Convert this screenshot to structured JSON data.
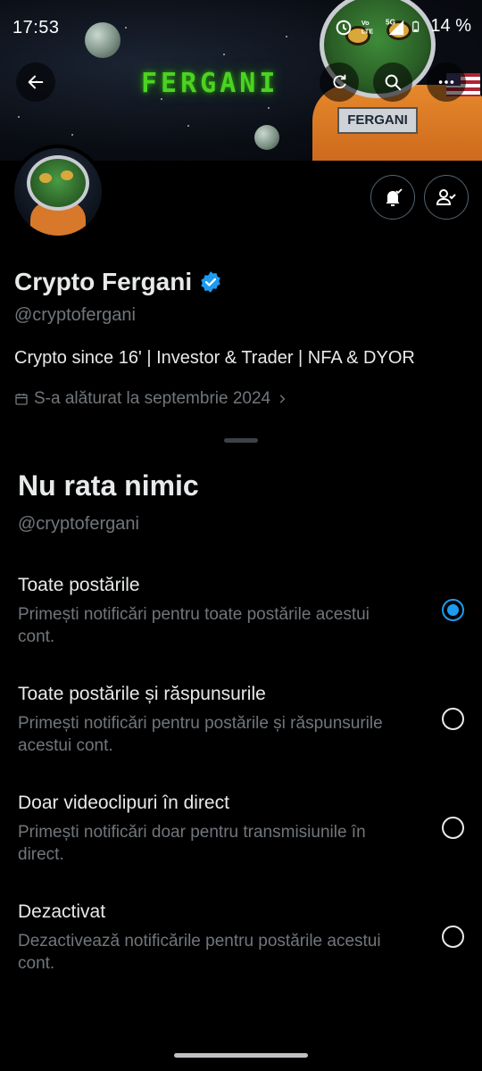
{
  "status_bar": {
    "time": "17:53",
    "battery": "14 %",
    "icons": [
      "alarm-icon",
      "volte-icon",
      "5g-icon",
      "signal-icon",
      "battery-icon"
    ]
  },
  "banner": {
    "title_text": "FERGANI",
    "suit_tag": "FERGANI"
  },
  "header_actions": [
    "back-arrow-icon",
    "refresh-icon",
    "search-icon",
    "more-icon"
  ],
  "profile": {
    "name": "Crypto Fergani",
    "handle": "@cryptofergani",
    "bio": "Crypto since 16' | Investor & Trader | NFA & DYOR",
    "joined": "S-a alăturat la septembrie 2024",
    "accent_color": "#1d9bf0"
  },
  "sheet": {
    "title": "Nu rata nimic",
    "subtitle": "@cryptofergani",
    "options": [
      {
        "title": "Toate postările",
        "desc": "Primești notificări pentru toate postările acestui cont.",
        "selected": true
      },
      {
        "title": "Toate postările și răspunsurile",
        "desc": "Primești notificări pentru postările și răspunsurile acestui cont.",
        "selected": false
      },
      {
        "title": "Doar videoclipuri în direct",
        "desc": "Primești notificări doar pentru transmisiunile în direct.",
        "selected": false
      },
      {
        "title": "Dezactivat",
        "desc": "Dezactivează notificările pentru postările acestui cont.",
        "selected": false
      }
    ]
  }
}
